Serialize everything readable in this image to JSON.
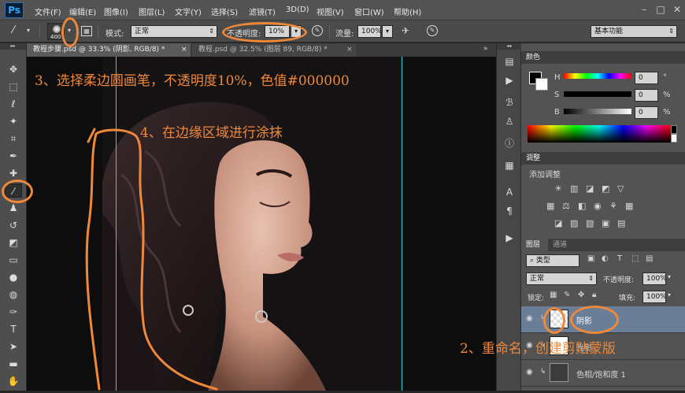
{
  "app": {
    "logo": "Ps"
  },
  "menu": [
    "文件(F)",
    "编辑(E)",
    "图像(I)",
    "图层(L)",
    "文字(Y)",
    "选择(S)",
    "滤镜(T)",
    "3D(D)",
    "视图(V)",
    "窗口(W)",
    "帮助(H)"
  ],
  "options": {
    "brush_size": "400",
    "mode_label": "模式:",
    "mode_value": "正常",
    "opacity_label": "不透明度:",
    "opacity_value": "10%",
    "flow_label": "流量:",
    "flow_value": "100%",
    "workspace": "基本功能"
  },
  "tabs": [
    {
      "label": "教程步骤.psd @ 33.3% (阴影, RGB/8) *",
      "close": "×"
    },
    {
      "label": "教程.psd @ 32.5% (图层 89, RGB/8) *",
      "close": "×"
    }
  ],
  "panels": {
    "color": {
      "tab": "颜色",
      "h": "H",
      "s": "S",
      "b": "B",
      "h_val": "0",
      "s_val": "0",
      "b_val": "0",
      "unit": "°",
      "pct": "%"
    },
    "adjust": {
      "tab": "调整",
      "title": "添加调整"
    },
    "layers": {
      "tab": "图层",
      "tab2": "通道",
      "filter": "类型",
      "blend": "正常",
      "opacity_label": "不透明度:",
      "opacity": "100%",
      "lock_label": "锁定:",
      "fill_label": "填充:",
      "fill": "100%",
      "rows": [
        {
          "name": "阴影"
        },
        {
          "name": "光影"
        },
        {
          "name": "色相/饱和度 1"
        }
      ]
    }
  },
  "annotations": {
    "step3": "3、选择柔边圆画笔，不透明度10%，色值#000000",
    "step4": "4、在边缘区域进行涂抹",
    "step2": "2、重命名，创建剪贴蒙版"
  },
  "colors": {
    "accent": "#f0883a",
    "ps_blue": "#31a8ff"
  }
}
